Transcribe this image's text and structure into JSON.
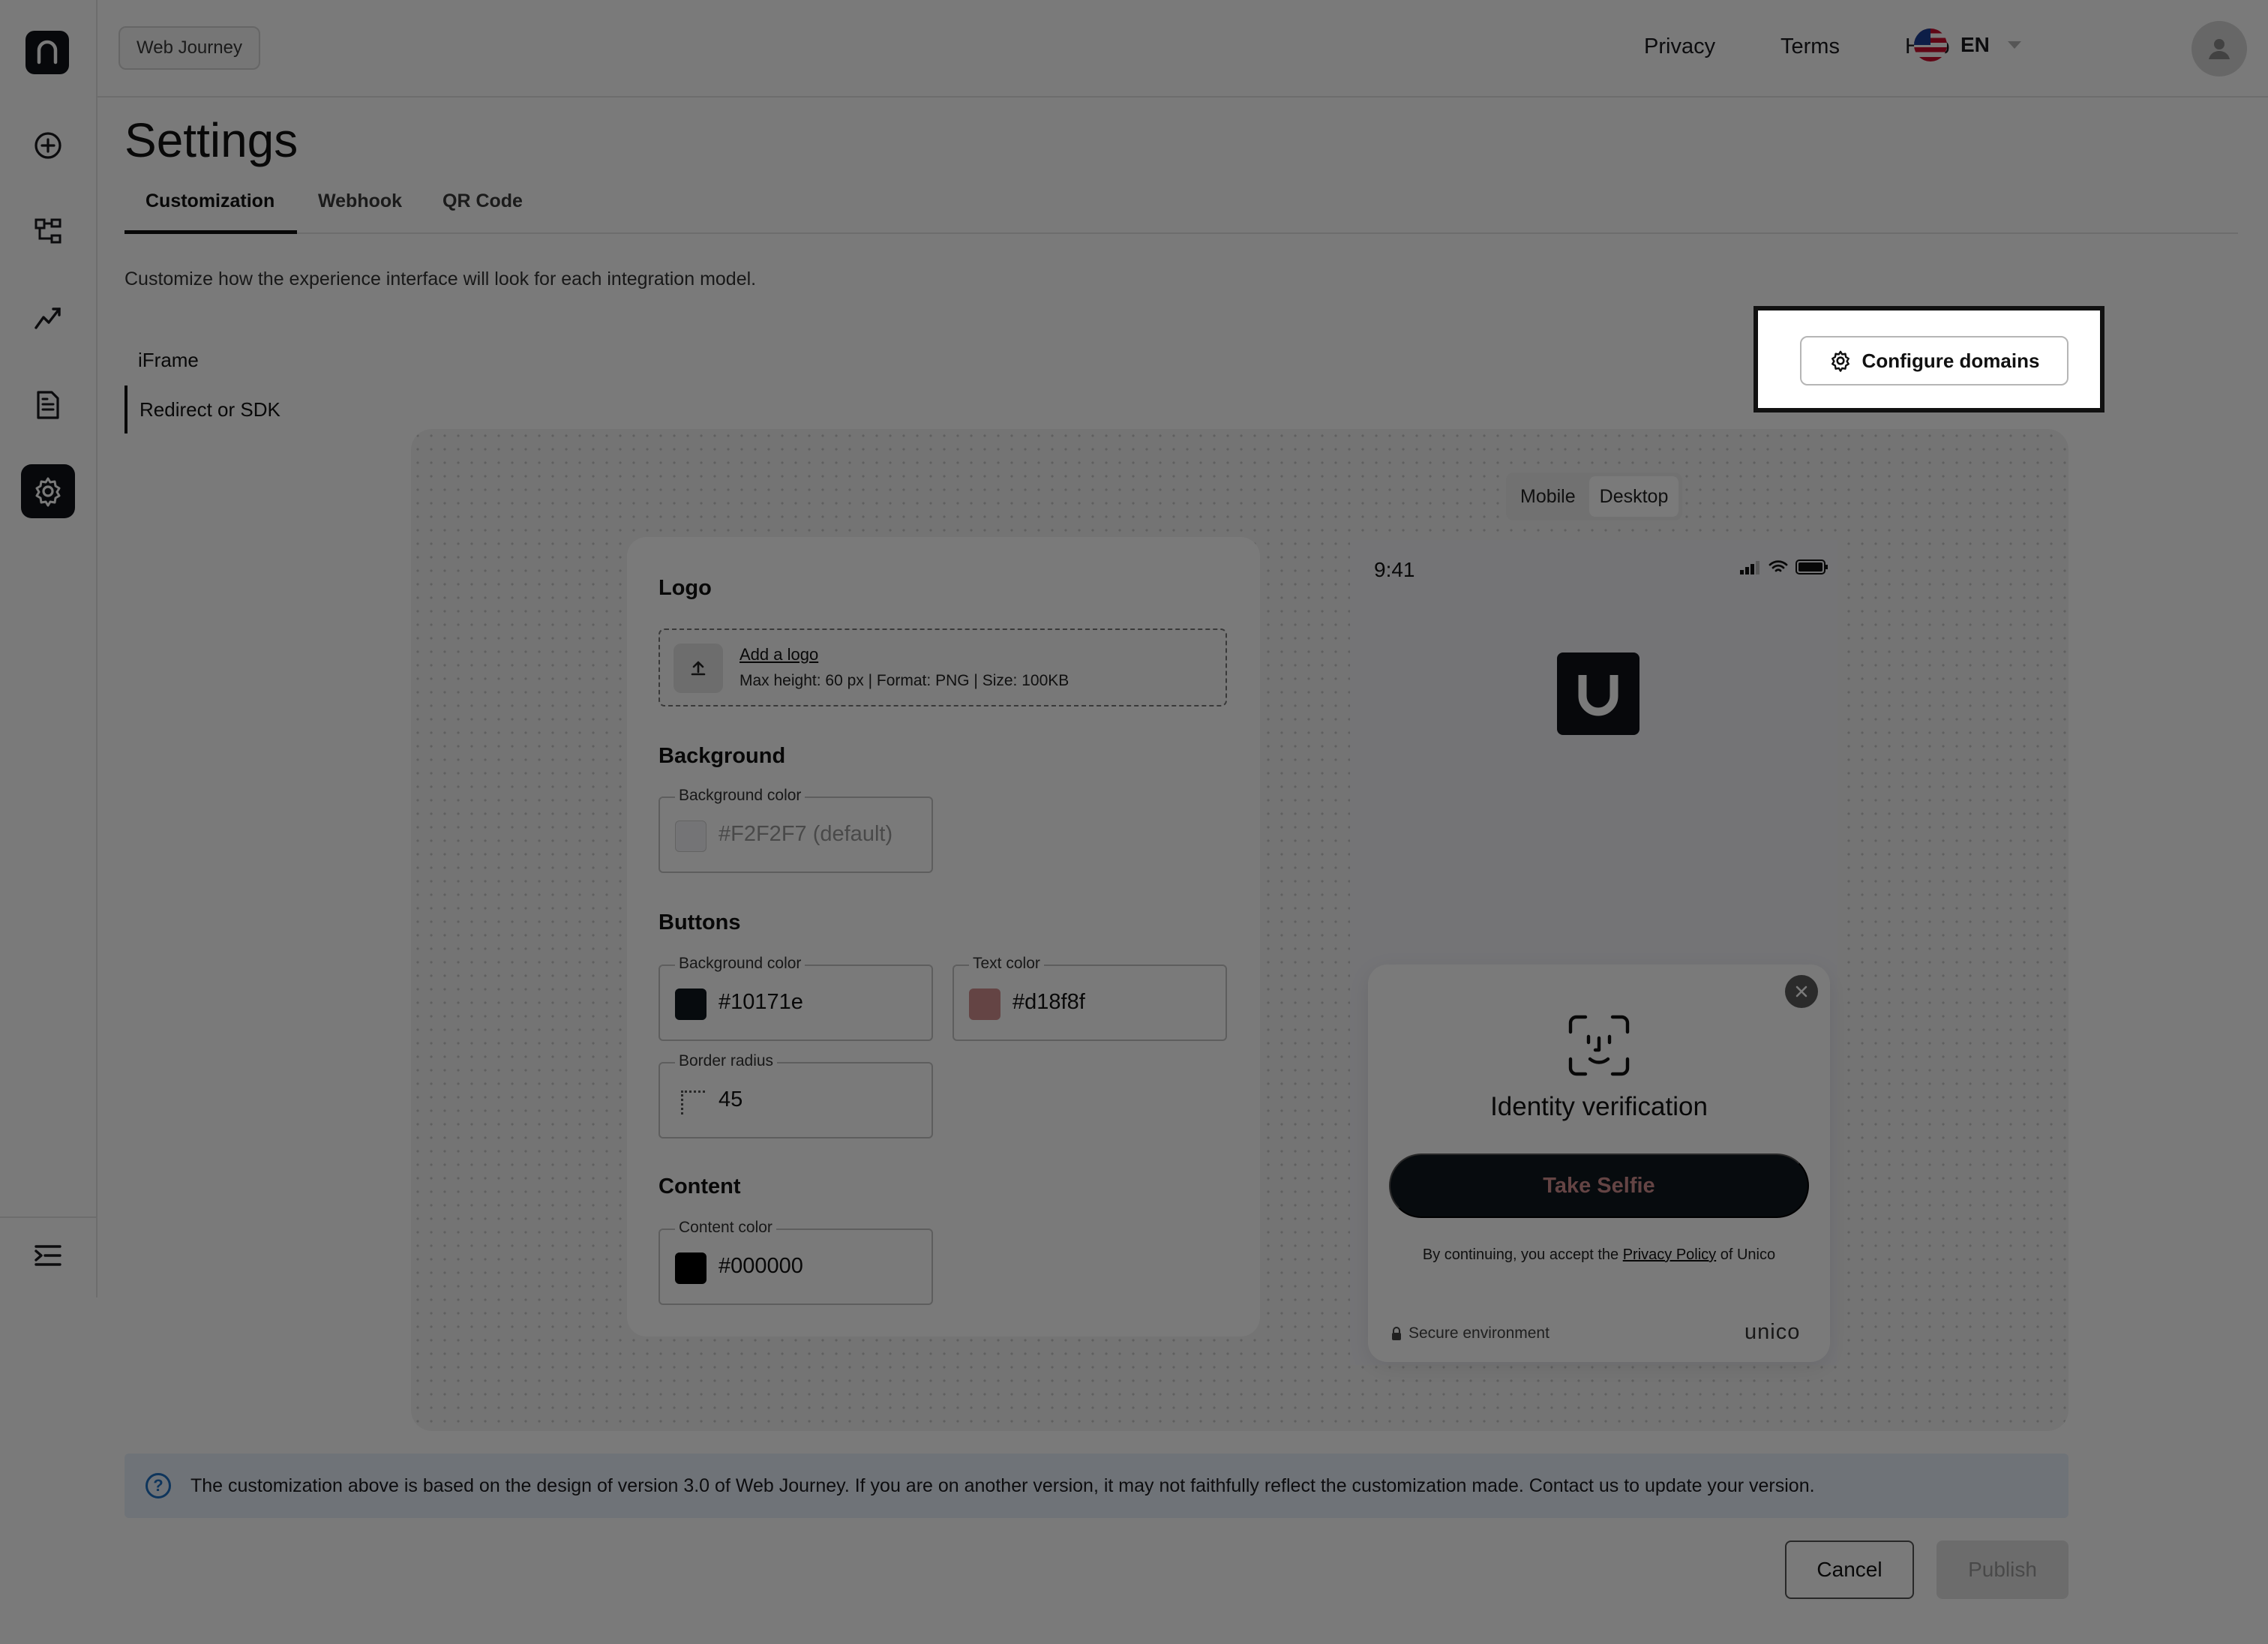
{
  "topbar": {
    "journey_label": "Web Journey",
    "links": [
      "Privacy",
      "Terms",
      "Help"
    ],
    "language": "EN"
  },
  "sidebar": {
    "items": [
      "plus-circle-icon",
      "flow-icon",
      "analytics-icon",
      "document-icon",
      "settings-icon"
    ],
    "active": "settings-icon",
    "footer_icon": "menu-collapse-icon"
  },
  "page": {
    "title": "Settings",
    "tabs": [
      "Customization",
      "Webhook",
      "QR Code"
    ],
    "active_tab": "Customization",
    "description": "Customize how the experience interface will look for each integration model.",
    "submenu": [
      "iFrame",
      "Redirect or SDK"
    ],
    "active_submenu": "Redirect or SDK",
    "configure_domains_label": "Configure domains"
  },
  "form": {
    "logo": {
      "title": "Logo",
      "add_link": "Add a logo",
      "hint": "Max height: 60 px | Format: PNG | Size: 100KB"
    },
    "background": {
      "title": "Background",
      "color_label": "Background color",
      "color_value": "#F2F2F7 (default)",
      "swatch": "#F2F2F7"
    },
    "buttons": {
      "title": "Buttons",
      "bg_label": "Background color",
      "bg_value": "#10171e",
      "text_label": "Text color",
      "text_value": "#d18f8f",
      "radius_label": "Border radius",
      "radius_value": "45"
    },
    "content": {
      "title": "Content",
      "color_label": "Content color",
      "color_value": "#000000"
    }
  },
  "preview": {
    "toggle": [
      "Mobile",
      "Desktop"
    ],
    "active_toggle": "Desktop",
    "time": "9:41",
    "modal_title": "Identity verification",
    "cta": "Take Selfie",
    "consent_prefix": "By continuing, you accept the",
    "consent_link": "Privacy Policy",
    "consent_suffix": "of Unico",
    "secure_label": "Secure environment",
    "brand": "unico"
  },
  "info": {
    "text": "The customization above is based on the design of version 3.0 of Web Journey. If you are on another version, it may not faithfully reflect the customization made. Contact us to update your version."
  },
  "actions": {
    "cancel": "Cancel",
    "publish": "Publish"
  },
  "colors": {
    "primary_dark": "#0f1217",
    "button_bg": "#10171e",
    "button_text": "#d18f8f",
    "info_accent": "#1f6fc0"
  }
}
